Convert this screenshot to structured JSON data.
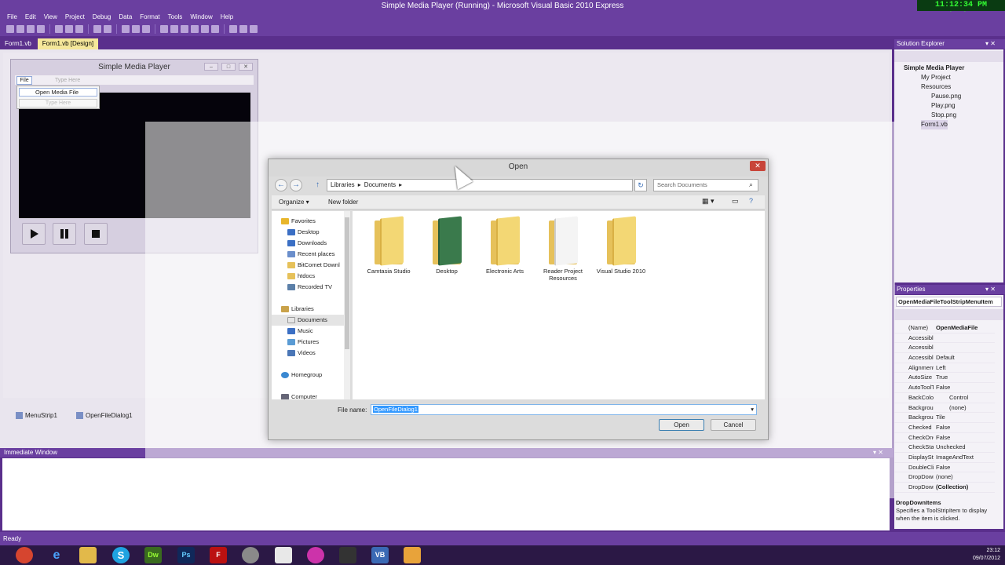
{
  "ide": {
    "title": "Simple Media Player (Running) - Microsoft Visual Basic 2010 Express",
    "clock": "11:12:34 PM 07/09/2012",
    "menu": [
      "File",
      "Edit",
      "View",
      "Project",
      "Debug",
      "Data",
      "Format",
      "Tools",
      "Window",
      "Help"
    ],
    "tabs": [
      "Form1.vb",
      "Form1.vb [Design]"
    ],
    "status": "Ready"
  },
  "form": {
    "title": "Simple Media Player",
    "menu_file": "File",
    "menu_typehere": "Type Here",
    "dropdown_item": "Open Media File",
    "dropdown_typehere": "Type Here"
  },
  "tray_components": [
    "MenuStrip1",
    "OpenFileDialog1"
  ],
  "immediate_window": {
    "title": "Immediate Window"
  },
  "solution_explorer": {
    "title": "Solution Explorer",
    "project": "Simple Media Player",
    "items": [
      "My Project",
      "Resources",
      "Pause.png",
      "Play.png",
      "Stop.png",
      "Form1.vb"
    ]
  },
  "properties": {
    "title": "Properties",
    "object": "OpenMediaFileToolStripMenuItem",
    "rows": [
      {
        "name": "(Name)",
        "value": "OpenMediaFile"
      },
      {
        "name": "AccessibleDe",
        "value": ""
      },
      {
        "name": "AccessibleNa",
        "value": ""
      },
      {
        "name": "AccessibleRol",
        "value": "Default"
      },
      {
        "name": "Alignment",
        "value": "Left"
      },
      {
        "name": "AutoSize",
        "value": "True"
      },
      {
        "name": "AutoToolTip",
        "value": "False"
      },
      {
        "name": "BackColor",
        "value": "Control"
      },
      {
        "name": "BackgroundIr",
        "value": "(none)"
      },
      {
        "name": "BackgroundIr",
        "value": "Tile"
      },
      {
        "name": "Checked",
        "value": "False"
      },
      {
        "name": "CheckOnClicl",
        "value": "False"
      },
      {
        "name": "CheckState",
        "value": "Unchecked"
      },
      {
        "name": "DisplayStyle",
        "value": "ImageAndText"
      },
      {
        "name": "DoubleClickE",
        "value": "False"
      },
      {
        "name": "DropDown",
        "value": "(none)"
      },
      {
        "name": "DropDownIte",
        "value": "(Collection)"
      }
    ],
    "desc_title": "DropDownItems",
    "desc_text": "Specifies a ToolStripItem to display when the item is clicked."
  },
  "dialog": {
    "title": "Open",
    "breadcrumb": [
      "Libraries",
      "Documents"
    ],
    "search_placeholder": "Search Documents",
    "organize": "Organize ▾",
    "new_folder": "New folder",
    "nav": [
      {
        "label": "Favorites",
        "type": "header"
      },
      {
        "label": "Desktop",
        "type": "item"
      },
      {
        "label": "Downloads",
        "type": "item"
      },
      {
        "label": "Recent places",
        "type": "item"
      },
      {
        "label": "BitComet Downl",
        "type": "item"
      },
      {
        "label": "htdocs",
        "type": "item"
      },
      {
        "label": "Recorded TV",
        "type": "item"
      },
      {
        "label": "Libraries",
        "type": "header"
      },
      {
        "label": "Documents",
        "type": "item"
      },
      {
        "label": "Music",
        "type": "item"
      },
      {
        "label": "Pictures",
        "type": "item"
      },
      {
        "label": "Videos",
        "type": "item"
      },
      {
        "label": "Homegroup",
        "type": "header"
      },
      {
        "label": "Computer",
        "type": "header"
      }
    ],
    "folders": [
      "Camtasia Studio",
      "Desktop",
      "Electronic Arts",
      "Reader Project Resources",
      "Visual Studio 2010"
    ],
    "file_name_label": "File name:",
    "file_name_value": "OpenFileDialog1",
    "open_label": "Open",
    "cancel_label": "Cancel"
  },
  "taskbar": {
    "time": "23:12",
    "date": "09/07/2012",
    "apps": [
      "Dw",
      "Ps",
      "Fz"
    ]
  }
}
